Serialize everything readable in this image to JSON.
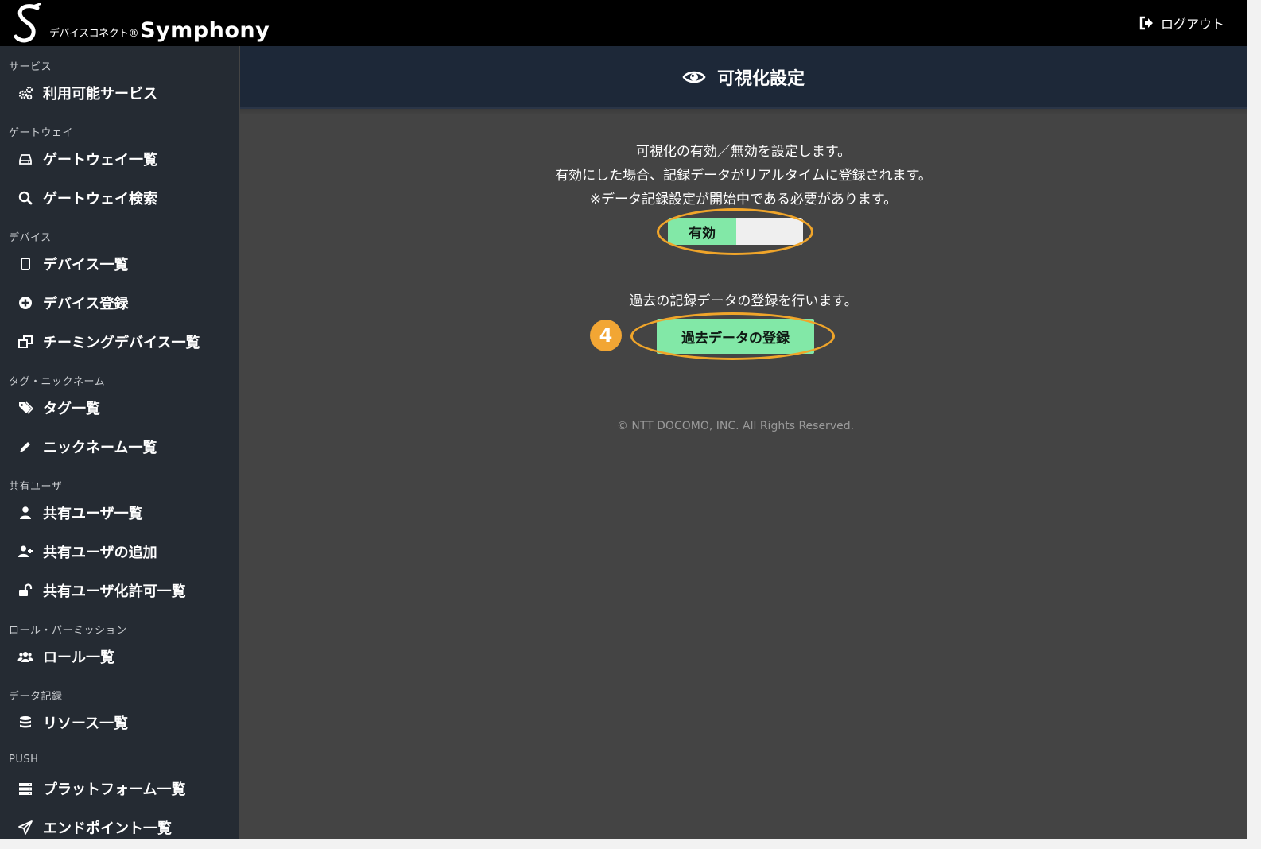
{
  "header": {
    "brand_jp": "デバイスコネクト®",
    "brand_en": "Symphony",
    "logout_label": "ログアウト"
  },
  "sidebar": {
    "groups": [
      {
        "label": "サービス",
        "items": [
          {
            "label": "利用可能サービス",
            "icon": "gears-icon"
          }
        ]
      },
      {
        "label": "ゲートウェイ",
        "items": [
          {
            "label": "ゲートウェイ一覧",
            "icon": "hdd-icon"
          },
          {
            "label": "ゲートウェイ検索",
            "icon": "search-icon"
          }
        ]
      },
      {
        "label": "デバイス",
        "items": [
          {
            "label": "デバイス一覧",
            "icon": "tablet-icon"
          },
          {
            "label": "デバイス登録",
            "icon": "plus-circle-icon"
          },
          {
            "label": "チーミングデバイス一覧",
            "icon": "clone-icon"
          }
        ]
      },
      {
        "label": "タグ・ニックネーム",
        "items": [
          {
            "label": "タグ一覧",
            "icon": "tags-icon"
          },
          {
            "label": "ニックネーム一覧",
            "icon": "pencil-icon"
          }
        ]
      },
      {
        "label": "共有ユーザ",
        "items": [
          {
            "label": "共有ユーザ一覧",
            "icon": "user-icon"
          },
          {
            "label": "共有ユーザの追加",
            "icon": "user-plus-icon"
          },
          {
            "label": "共有ユーザ化許可一覧",
            "icon": "unlock-icon"
          }
        ]
      },
      {
        "label": "ロール・パーミッション",
        "items": [
          {
            "label": "ロール一覧",
            "icon": "users-icon"
          }
        ]
      },
      {
        "label": "データ記録",
        "items": [
          {
            "label": "リソース一覧",
            "icon": "database-icon"
          }
        ]
      },
      {
        "label": "PUSH",
        "items": [
          {
            "label": "プラットフォーム一覧",
            "icon": "server-icon"
          },
          {
            "label": "エンドポイント一覧",
            "icon": "paper-plane-icon"
          }
        ]
      }
    ]
  },
  "main": {
    "title": "可視化設定",
    "title_icon": "eye-icon",
    "desc_line1": "可視化の有効／無効を設定します。",
    "desc_line2": "有効にした場合、記録データがリアルタイムに登録されます。",
    "desc_line3": "※データ記録設定が開始中である必要があります。",
    "toggle_label": "有効",
    "toggle_state": "on",
    "past_desc": "過去の記録データの登録を行います。",
    "past_button_label": "過去データの登録",
    "step_number": "4",
    "footer": "© NTT DOCOMO, INC. All Rights Reserved."
  },
  "colors": {
    "accent_green": "#82e8a7",
    "highlight_orange": "#f0a52a",
    "sidebar_bg": "#252b33",
    "header_bg": "#1d2838",
    "content_bg": "#444444"
  }
}
